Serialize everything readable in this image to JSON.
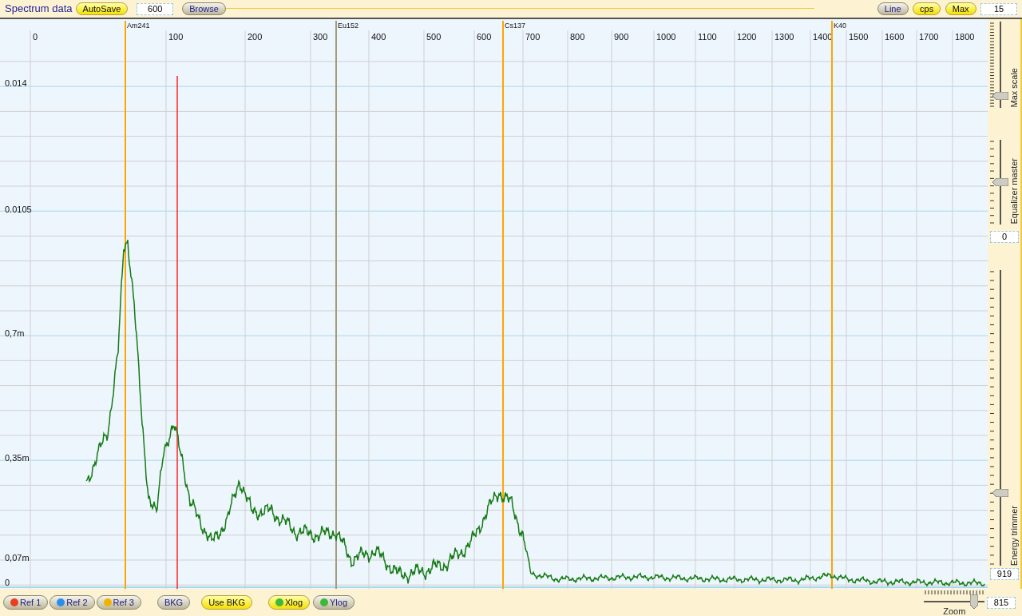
{
  "header": {
    "title": "Spectrum data",
    "left": [
      {
        "kind": "button",
        "label": "AutoSave",
        "on": true
      },
      {
        "kind": "field",
        "value": "600"
      },
      {
        "kind": "button",
        "label": "Browse",
        "on": false
      }
    ],
    "right": [
      {
        "kind": "button",
        "label": "Line",
        "on": false
      },
      {
        "kind": "button",
        "label": "cps",
        "on": true
      },
      {
        "kind": "button",
        "label": "Max",
        "on": true
      },
      {
        "kind": "field",
        "value": "15"
      }
    ]
  },
  "chart": {
    "x_ticks": [
      "0",
      "100",
      "200",
      "300",
      "400",
      "500",
      "600",
      "700",
      "800",
      "900",
      "1000",
      "1100",
      "1200",
      "1300",
      "1400",
      "1500",
      "1600",
      "1700",
      "1800"
    ],
    "y_ticks": [
      "0.014",
      "0.0105",
      "0,7m",
      "0,35m",
      "0,07m",
      "0"
    ],
    "markers": [
      {
        "label": "Am241",
        "color": "#ffa500"
      },
      {
        "label": "Eu152",
        "color": "#a09c7c"
      },
      {
        "label": "Cs137",
        "color": "#ffa500"
      },
      {
        "label": "K40",
        "color": "#ffa500"
      }
    ]
  },
  "sliders": [
    {
      "label": "Max scale",
      "level": 0.1
    },
    {
      "label": "Equalizer master",
      "level": 0.5,
      "value": "0"
    },
    {
      "label": "Energy trimmer",
      "level": 0.24,
      "value": "919"
    }
  ],
  "zoom": {
    "label": "Zoom",
    "level": 0.83,
    "value": "815"
  },
  "bottom_buttons": [
    {
      "label": "Ref 1",
      "on": false,
      "color": "#e8401e"
    },
    {
      "label": "Ref 2",
      "on": false,
      "color": "#2a8ef0"
    },
    {
      "label": "Ref 3",
      "on": false,
      "color": "#f0b400"
    },
    {
      "label": "BKG",
      "on": false
    },
    {
      "label": "Use BKG",
      "on": true
    },
    {
      "label": "Xlog",
      "on": true,
      "color": "#3cb83c"
    },
    {
      "label": "Ylog",
      "on": false,
      "color": "#3cb83c"
    }
  ]
}
